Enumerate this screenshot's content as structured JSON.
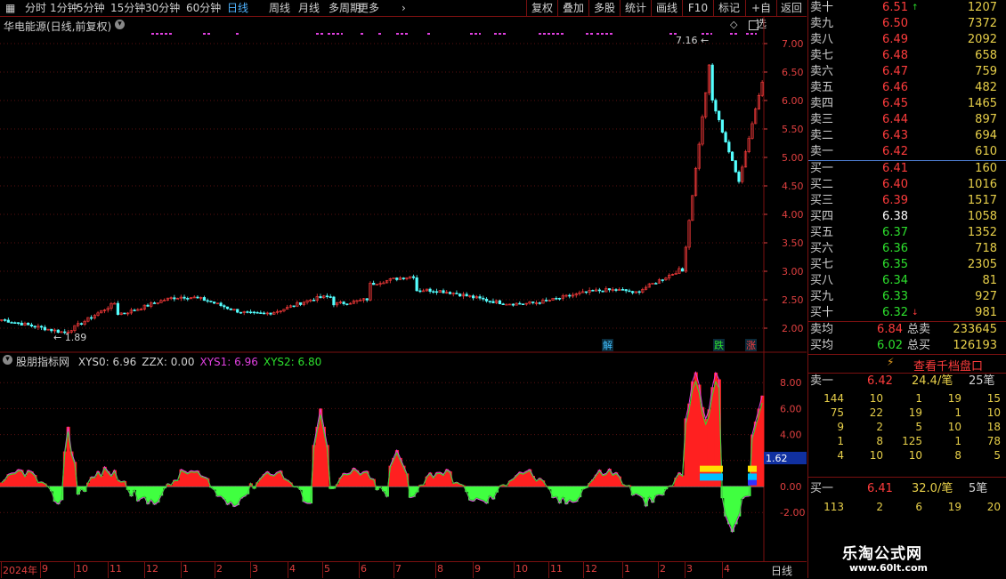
{
  "toolbar": {
    "left_items": [
      {
        "label": "分时",
        "active": false
      },
      {
        "label": "1分钟",
        "active": false
      },
      {
        "label": "5分钟",
        "active": false
      },
      {
        "label": "15分钟",
        "active": false
      },
      {
        "label": "30分钟",
        "active": false
      },
      {
        "label": "60分钟",
        "active": false
      },
      {
        "label": "日线",
        "active": true
      },
      {
        "label": "周线",
        "active": false
      },
      {
        "label": "月线",
        "active": false
      },
      {
        "label": "多周期",
        "active": false
      },
      {
        "label": "更多",
        "active": false
      }
    ],
    "right_buttons": [
      "复权",
      "叠加",
      "多股",
      "统计",
      "画线",
      "F10",
      "标记",
      "+自选",
      "返回"
    ]
  },
  "main_chart": {
    "title": "华电能源(日线,前复权)",
    "y_ticks": [
      "7.00",
      "6.50",
      "6.00",
      "5.50",
      "5.00",
      "4.50",
      "4.00",
      "3.50",
      "3.00",
      "2.50",
      "2.00"
    ],
    "high_label": "7.16",
    "low_label": "1.89",
    "markers": [
      "解",
      "跌",
      "涨"
    ]
  },
  "indicator": {
    "name": "股朋指标网",
    "values": [
      {
        "label": "XYS0: 6.96",
        "color": "#d0d0d0"
      },
      {
        "label": "ZZX: 0.00",
        "color": "#d0d0d0"
      },
      {
        "label": "XYS1: 6.96",
        "color": "#e040e0"
      },
      {
        "label": "XYS2: 6.80",
        "color": "#2de02d"
      }
    ],
    "y_ticks": [
      "8.00",
      "6.00",
      "4.00",
      "2.00",
      "0.00",
      "-2.00"
    ],
    "cursor_value": "1.62"
  },
  "date_axis": {
    "labels": [
      "2024年",
      "9",
      "10",
      "11",
      "12",
      "1",
      "2",
      "3",
      "4",
      "5",
      "6",
      "7",
      "8",
      "9",
      "10",
      "11",
      "12",
      "1",
      "2",
      "3",
      "4"
    ],
    "period": "日线"
  },
  "order_book": {
    "asks": [
      {
        "label": "卖十",
        "price": "6.51",
        "vol": "1207",
        "mark": "↑"
      },
      {
        "label": "卖九",
        "price": "6.50",
        "vol": "7372"
      },
      {
        "label": "卖八",
        "price": "6.49",
        "vol": "2092"
      },
      {
        "label": "卖七",
        "price": "6.48",
        "vol": "658"
      },
      {
        "label": "卖六",
        "price": "6.47",
        "vol": "759"
      },
      {
        "label": "卖五",
        "price": "6.46",
        "vol": "482"
      },
      {
        "label": "卖四",
        "price": "6.45",
        "vol": "1465"
      },
      {
        "label": "卖三",
        "price": "6.44",
        "vol": "897"
      },
      {
        "label": "卖二",
        "price": "6.43",
        "vol": "694"
      },
      {
        "label": "卖一",
        "price": "6.42",
        "vol": "610"
      }
    ],
    "bids": [
      {
        "label": "买一",
        "price": "6.41",
        "vol": "160",
        "color": "red"
      },
      {
        "label": "买二",
        "price": "6.40",
        "vol": "1016",
        "color": "red"
      },
      {
        "label": "买三",
        "price": "6.39",
        "vol": "1517",
        "color": "red"
      },
      {
        "label": "买四",
        "price": "6.38",
        "vol": "1058",
        "color": "white"
      },
      {
        "label": "买五",
        "price": "6.37",
        "vol": "1352",
        "color": "green"
      },
      {
        "label": "买六",
        "price": "6.36",
        "vol": "718",
        "color": "green"
      },
      {
        "label": "买七",
        "price": "6.35",
        "vol": "2305",
        "color": "green"
      },
      {
        "label": "买八",
        "price": "6.34",
        "vol": "81",
        "color": "green"
      },
      {
        "label": "买九",
        "price": "6.33",
        "vol": "927",
        "color": "green"
      },
      {
        "label": "买十",
        "price": "6.32",
        "vol": "981",
        "color": "green",
        "mark": "↓"
      }
    ],
    "avg_sell_label": "卖均",
    "avg_sell": "6.84",
    "total_sell_label": "总卖",
    "total_sell": "233645",
    "avg_buy_label": "买均",
    "avg_buy": "6.02",
    "total_buy_label": "总买",
    "total_buy": "126193"
  },
  "depth": {
    "button": "查看千档盘口",
    "sell_label": "卖一",
    "sell_price": "6.42",
    "sell_per": "24.4/笔",
    "sell_count": "25笔",
    "sell_grid": [
      [
        "144",
        "10",
        "1",
        "19",
        "15"
      ],
      [
        "75",
        "22",
        "19",
        "1",
        "10"
      ],
      [
        "9",
        "2",
        "5",
        "10",
        "18"
      ],
      [
        "1",
        "8",
        "125",
        "1",
        "78"
      ],
      [
        "4",
        "10",
        "10",
        "8",
        "5"
      ]
    ],
    "buy_label": "买一",
    "buy_price": "6.41",
    "buy_per": "32.0/笔",
    "buy_count": "5笔",
    "buy_grid": [
      [
        "113",
        "2",
        "6",
        "19",
        "20"
      ]
    ]
  },
  "watermark": {
    "title": "乐淘公式网",
    "url": "www.60lt.com"
  }
}
